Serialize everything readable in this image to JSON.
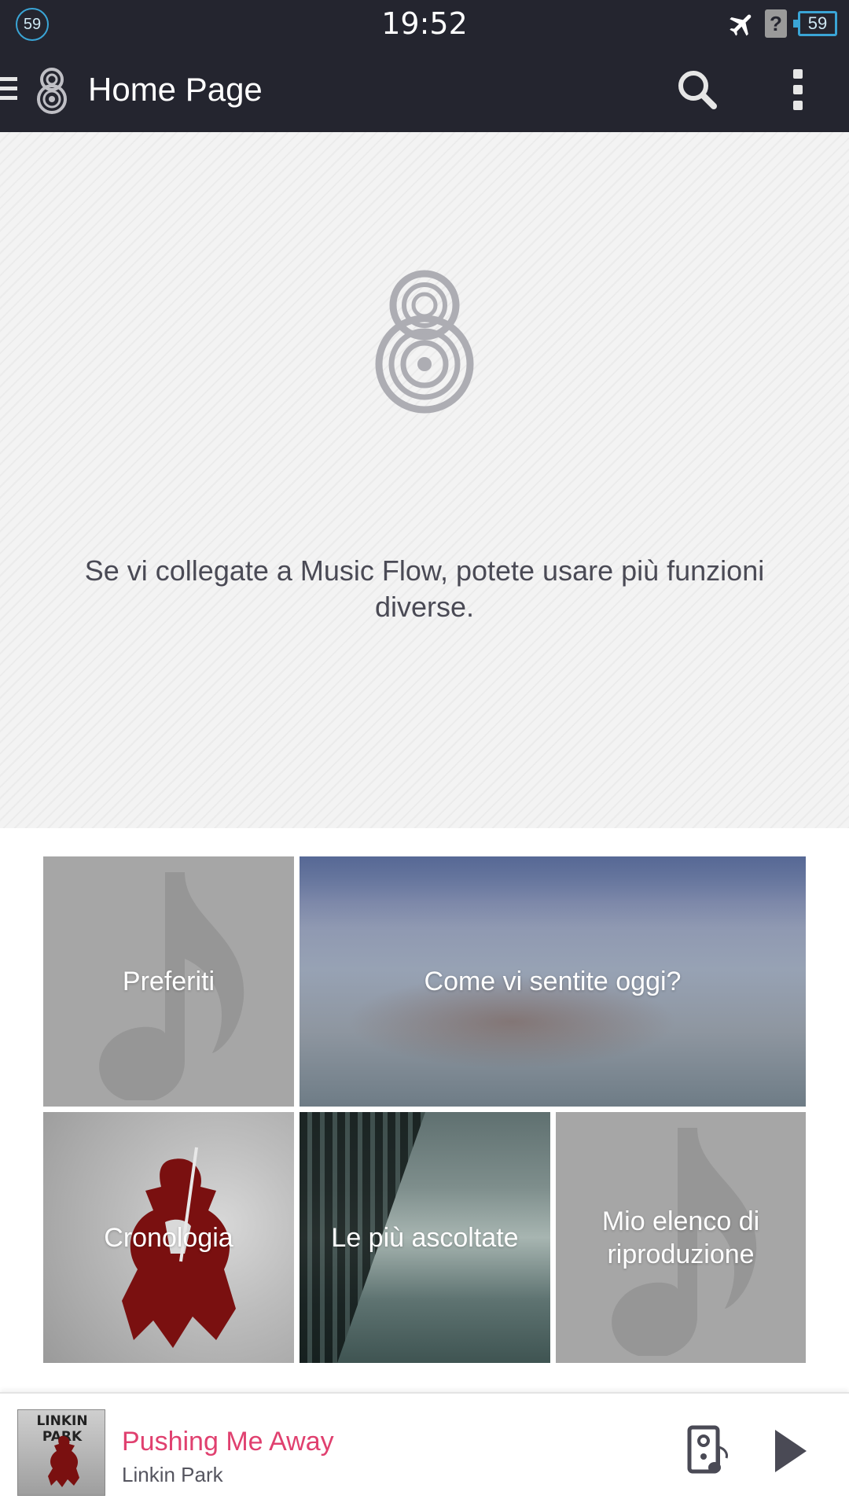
{
  "status_bar": {
    "notification_count": "59",
    "time": "19:52",
    "battery": "59",
    "icons": [
      "airplane-mode-icon",
      "unknown-sim-icon",
      "battery-icon"
    ]
  },
  "app_bar": {
    "title": "Home Page",
    "icons": [
      "menu-icon",
      "music-flow-logo-icon",
      "search-icon",
      "overflow-menu-icon"
    ]
  },
  "hero": {
    "message": "Se vi collegate a Music Flow, potete usare più funzioni diverse."
  },
  "tiles": [
    {
      "label": "Preferiti"
    },
    {
      "label": "Come vi sentite oggi?"
    },
    {
      "label": "Cronologia"
    },
    {
      "label": "Le più ascoltate"
    },
    {
      "label": "Mio elenco di riproduzione"
    }
  ],
  "now_playing": {
    "album_art_text": "LINKIN PARK",
    "title": "Pushing Me Away",
    "artist": "Linkin Park",
    "title_color": "#e0406f"
  },
  "colors": {
    "app_bar": "#24252f",
    "accent": "#3aa5d6",
    "tile_gray": "#a6a6a6"
  }
}
